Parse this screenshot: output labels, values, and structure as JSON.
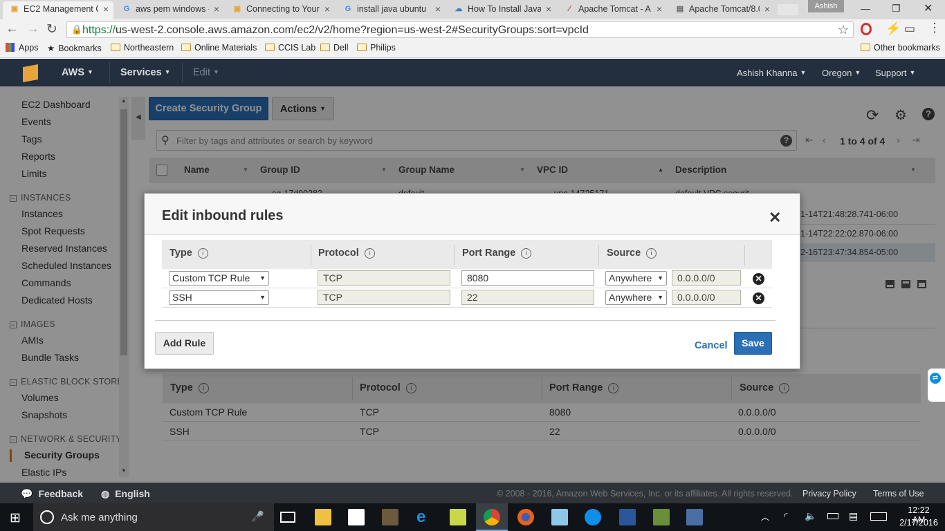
{
  "browser": {
    "tabs": [
      {
        "label": "EC2 Management C",
        "icon": "aws-icon",
        "active": true
      },
      {
        "label": "aws pem windows -",
        "icon": "google-icon"
      },
      {
        "label": "Connecting to Your",
        "icon": "aws-icon"
      },
      {
        "label": "install java ubuntu",
        "icon": "google-icon"
      },
      {
        "label": "How To Install Java",
        "icon": "cloud-icon"
      },
      {
        "label": "Apache Tomcat - A",
        "icon": "feather-icon"
      },
      {
        "label": "Apache Tomcat/8.0",
        "icon": "page-icon"
      }
    ],
    "profile_name": "Ashish",
    "url_scheme": "https://",
    "url_rest": "us-west-2.console.aws.amazon.com/ec2/v2/home?region=us-west-2#SecurityGroups:sort=vpcId",
    "bookmarks": [
      "Apps",
      "Bookmarks",
      "Northeastern",
      "Online Materials",
      "CCIS Lab",
      "Dell",
      "Philips"
    ],
    "other_bookmarks": "Other bookmarks"
  },
  "aws_header": {
    "logo_text": "AWS",
    "services": "Services",
    "edit": "Edit",
    "user": "Ashish Khanna",
    "region": "Oregon",
    "support": "Support"
  },
  "sidebar": {
    "top_items": [
      "EC2 Dashboard",
      "Events",
      "Tags",
      "Reports",
      "Limits"
    ],
    "sections": [
      {
        "header": "INSTANCES",
        "items": [
          "Instances",
          "Spot Requests",
          "Reserved Instances",
          "Scheduled Instances",
          "Commands",
          "Dedicated Hosts"
        ]
      },
      {
        "header": "IMAGES",
        "items": [
          "AMIs",
          "Bundle Tasks"
        ]
      },
      {
        "header": "ELASTIC BLOCK STORE",
        "items": [
          "Volumes",
          "Snapshots"
        ]
      },
      {
        "header": "NETWORK & SECURITY",
        "items": [
          "Security Groups",
          "Elastic IPs"
        ]
      }
    ],
    "active_item": "Security Groups"
  },
  "toolbar": {
    "create_label": "Create Security Group",
    "actions_label": "Actions",
    "filter_placeholder": "Filter by tags and attributes or search by keyword",
    "pagination": "1 to 4 of 4"
  },
  "grid": {
    "columns": [
      "Name",
      "Group ID",
      "Group Name",
      "VPC ID",
      "Description"
    ],
    "partial_rows": [
      {
        "c1": "sg-17d90383",
        "c2": "default",
        "c3": "vpc-14725171",
        "c4": "default VPC securit"
      },
      {
        "c4": "1-14T21:48:28.741-06:00"
      },
      {
        "c4": "1-14T22:22:02.870-06:00"
      },
      {
        "c4": "2-16T23:47:34.854-05:00"
      }
    ]
  },
  "modal": {
    "title": "Edit inbound rules",
    "columns": [
      "Type",
      "Protocol",
      "Port Range",
      "Source"
    ],
    "rows": [
      {
        "type": "Custom TCP Rule",
        "protocol": "TCP",
        "port": "8080",
        "source_sel": "Anywhere",
        "source_val": "0.0.0.0/0"
      },
      {
        "type": "SSH",
        "protocol": "TCP",
        "port": "22",
        "source_sel": "Anywhere",
        "source_val": "0.0.0.0/0"
      }
    ],
    "add_rule": "Add Rule",
    "cancel": "Cancel",
    "save": "Save"
  },
  "details": {
    "columns": [
      "Type",
      "Protocol",
      "Port Range",
      "Source"
    ],
    "rows": [
      {
        "type": "Custom TCP Rule",
        "protocol": "TCP",
        "port": "8080",
        "source": "0.0.0.0/0"
      },
      {
        "type": "SSH",
        "protocol": "TCP",
        "port": "22",
        "source": "0.0.0.0/0"
      }
    ]
  },
  "footer": {
    "feedback": "Feedback",
    "language": "English",
    "copyright": "© 2008 - 2016, Amazon Web Services, Inc. or its affiliates. All rights reserved.",
    "privacy": "Privacy Policy",
    "terms": "Terms of Use"
  },
  "taskbar": {
    "search_placeholder": "Ask me anything",
    "time": "12:22 AM",
    "date": "2/17/2016"
  },
  "colors": {
    "aws_nav": "#232f3e",
    "primary_button": "#2b6fb5",
    "accent": "#e47911"
  }
}
